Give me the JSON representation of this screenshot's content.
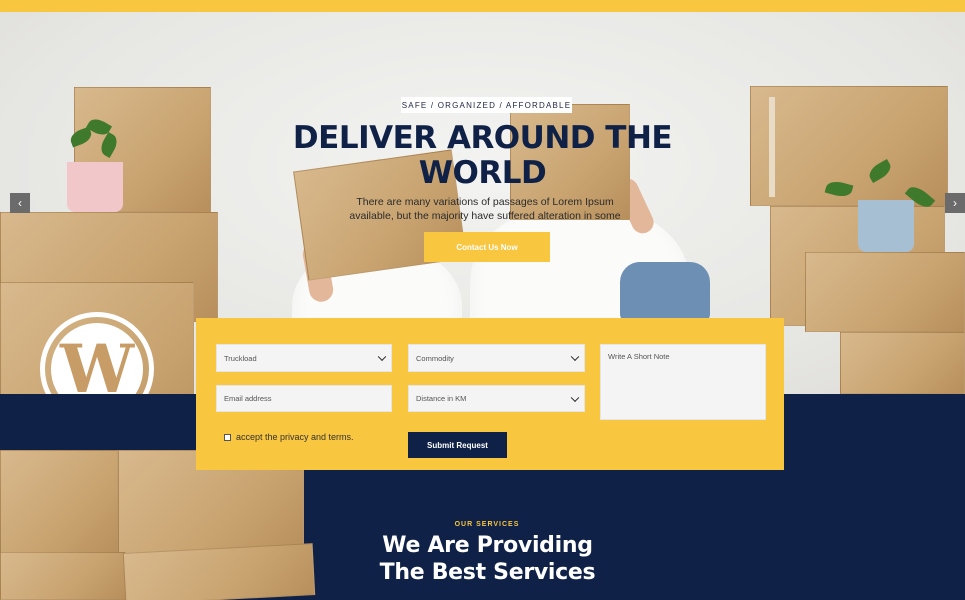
{
  "hero": {
    "badge": "SAFE / ORGANIZED / AFFORDABLE",
    "title_line1": "DELIVER AROUND THE",
    "title_line2": "WORLD",
    "text_line1": "There are many variations of passages of Lorem Ipsum",
    "text_line2": "available, but the majority have suffered alteration in some",
    "cta_label": "Contact Us Now",
    "prev_arrow": "‹",
    "next_arrow": "›"
  },
  "form": {
    "select1": "Truckload",
    "select2": "Commodity",
    "email_placeholder": "Email address",
    "select3": "Distance in KM",
    "note_placeholder": "Write A Short Note",
    "privacy_label": "accept the privacy and terms.",
    "submit_label": "Submit Request"
  },
  "services": {
    "tag": "OUR SERVICES",
    "title_line1": "We Are Providing",
    "title_line2": "The Best Services"
  },
  "brand": {
    "logo_letter": "W"
  },
  "colors": {
    "accent": "#f8c63f",
    "navy": "#0f2146"
  }
}
